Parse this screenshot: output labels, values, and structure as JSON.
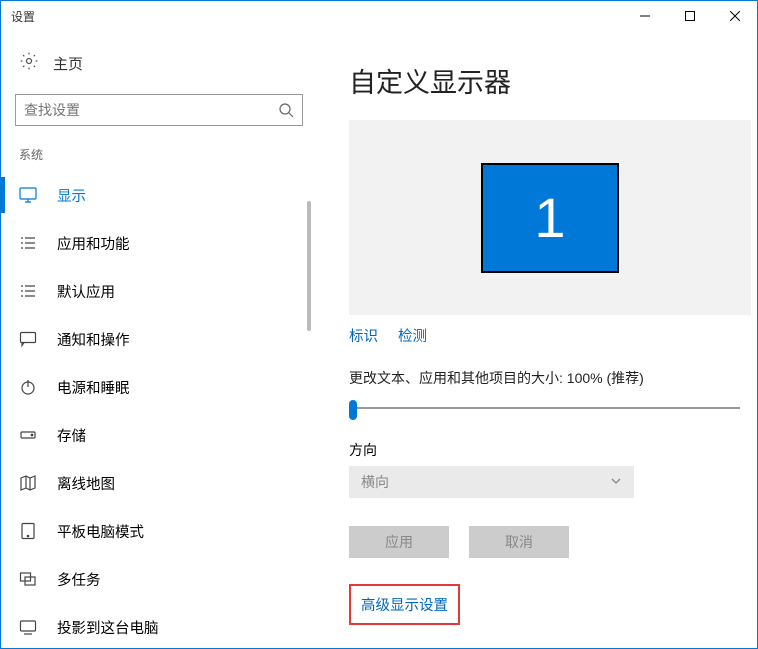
{
  "window": {
    "title": "设置"
  },
  "sidebar": {
    "home_label": "主页",
    "search_placeholder": "查找设置",
    "section_label": "系统",
    "items": [
      {
        "label": "显示"
      },
      {
        "label": "应用和功能"
      },
      {
        "label": "默认应用"
      },
      {
        "label": "通知和操作"
      },
      {
        "label": "电源和睡眠"
      },
      {
        "label": "存储"
      },
      {
        "label": "离线地图"
      },
      {
        "label": "平板电脑模式"
      },
      {
        "label": "多任务"
      },
      {
        "label": "投影到这台电脑"
      }
    ]
  },
  "content": {
    "title": "自定义显示器",
    "monitor_number": "1",
    "identify_label": "标识",
    "detect_label": "检测",
    "scale_label": "更改文本、应用和其他项目的大小: 100% (推荐)",
    "orientation_label": "方向",
    "orientation_value": "横向",
    "apply_label": "应用",
    "cancel_label": "取消",
    "advanced_label": "高级显示设置"
  }
}
